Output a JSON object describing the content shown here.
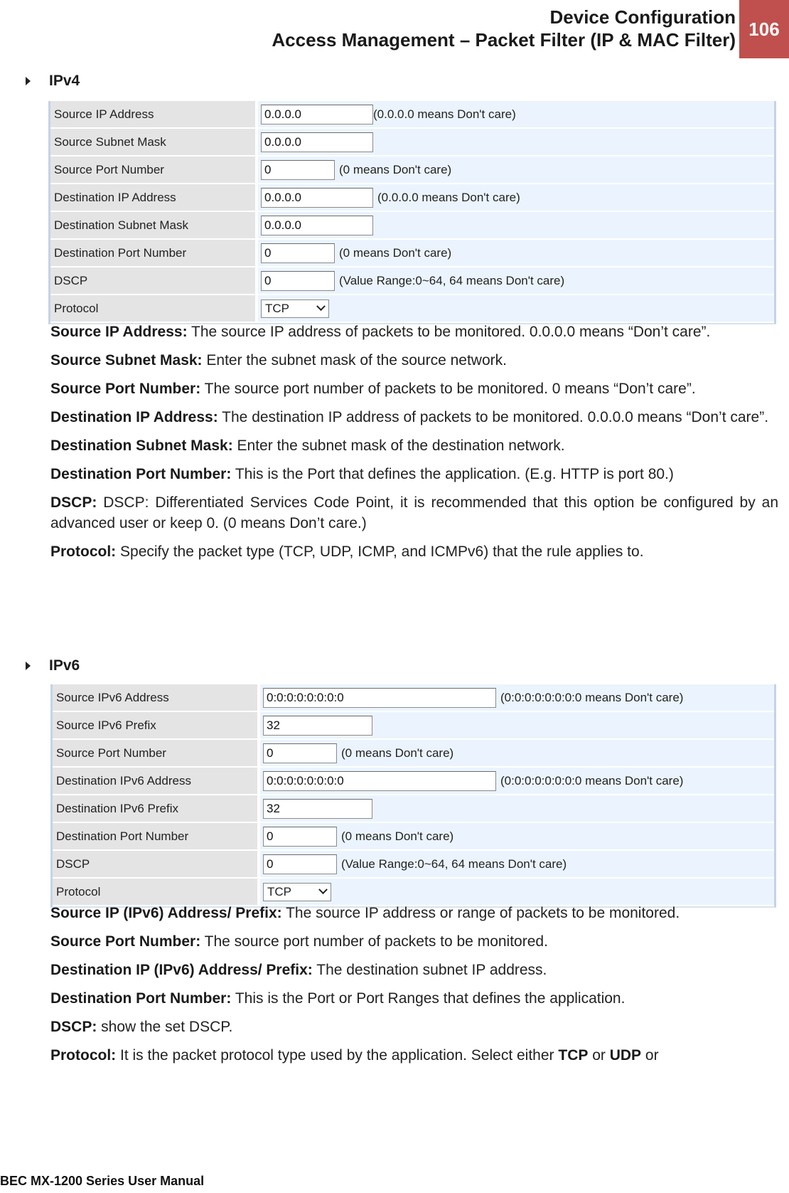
{
  "header": {
    "line1": "Device Configuration",
    "line2": "Access Management – Packet Filter (IP & MAC Filter)",
    "page_number": "106",
    "badge_color": "#c0504d"
  },
  "ipv4": {
    "heading": "IPv4",
    "rows": [
      {
        "label": "Source IP Address",
        "value": "0.0.0.0",
        "hint": "(0.0.0.0 means Don't care)"
      },
      {
        "label": "Source Subnet Mask",
        "value": "0.0.0.0",
        "hint": ""
      },
      {
        "label": "Source Port Number",
        "value": "0",
        "hint": "(0 means Don't care)"
      },
      {
        "label": "Destination IP Address",
        "value": "0.0.0.0",
        "hint": "(0.0.0.0 means Don't care)"
      },
      {
        "label": "Destination Subnet Mask",
        "value": "0.0.0.0",
        "hint": ""
      },
      {
        "label": "Destination Port Number",
        "value": "0",
        "hint": "(0 means Don't care)"
      },
      {
        "label": "DSCP",
        "value": "0",
        "hint": "(Value Range:0~64, 64 means Don't care)"
      },
      {
        "label": "Protocol",
        "value": "TCP",
        "hint": ""
      }
    ],
    "descriptions": [
      {
        "term": "Source IP Address:",
        "text": " The source IP address of packets to be monitored.  0.0.0.0 means “Don’t care”."
      },
      {
        "term": "Source Subnet Mask:",
        "text": " Enter the subnet mask of the source network."
      },
      {
        "term": "Source Port Number:",
        "text": " The source port number of packets to be monitored. 0 means “Don’t care”."
      },
      {
        "term": "Destination IP Address:",
        "text": " The destination IP address of packets to be monitored.  0.0.0.0 means “Don’t care”."
      },
      {
        "term": "Destination Subnet Mask:",
        "text": " Enter the subnet mask of the destination network."
      },
      {
        "term": "Destination Port Number:",
        "text": " This is the Port that defines the application. (E.g. HTTP is port 80.)"
      },
      {
        "term": "DSCP:",
        "text": " DSCP: Differentiated Services Code Point, it is recommended that this option be configured by an advanced user or keep 0. (0 means Don’t care.)"
      },
      {
        "term": "Protocol:",
        "text": " Specify the packet type (TCP, UDP, ICMP, and ICMPv6) that the rule applies to."
      }
    ]
  },
  "ipv6": {
    "heading": "IPv6",
    "rows": [
      {
        "label": "Source IPv6 Address",
        "value": "0:0:0:0:0:0:0:0",
        "hint": "(0:0:0:0:0:0:0:0 means Don't care)"
      },
      {
        "label": "Source IPv6 Prefix",
        "value": "32",
        "hint": ""
      },
      {
        "label": "Source Port Number",
        "value": "0",
        "hint": "(0 means Don't care)"
      },
      {
        "label": "Destination IPv6 Address",
        "value": "0:0:0:0:0:0:0:0",
        "hint": "(0:0:0:0:0:0:0:0 means Don't care)"
      },
      {
        "label": "Destination IPv6 Prefix",
        "value": "32",
        "hint": ""
      },
      {
        "label": "Destination Port Number",
        "value": "0",
        "hint": "(0 means Don't care)"
      },
      {
        "label": "DSCP",
        "value": "0",
        "hint": "(Value Range:0~64, 64 means Don't care)"
      },
      {
        "label": "Protocol",
        "value": "TCP",
        "hint": ""
      }
    ],
    "descriptions": [
      {
        "term": "Source IP (IPv6) Address/ Prefix:",
        "text": " The source IP address or range of packets to be monitored."
      },
      {
        "term": "Source Port Number:",
        "text": " The source port number of packets to be monitored."
      },
      {
        "term": "Destination IP (IPv6) Address/ Prefix:",
        "text": " The destination subnet IP address."
      },
      {
        "term": "Destination Port Number:",
        "text": " This is the Port or Port Ranges that defines the application."
      },
      {
        "term": "DSCP:",
        "text": " show the set DSCP."
      },
      {
        "term": "Protocol:",
        "text": " It is the packet protocol type used by the application. Select either ",
        "bold1": "TCP",
        "mid": " or ",
        "bold2": "UDP",
        "tail": " or"
      }
    ]
  },
  "footer": {
    "text": "BEC MX-1200 Series User Manual"
  }
}
